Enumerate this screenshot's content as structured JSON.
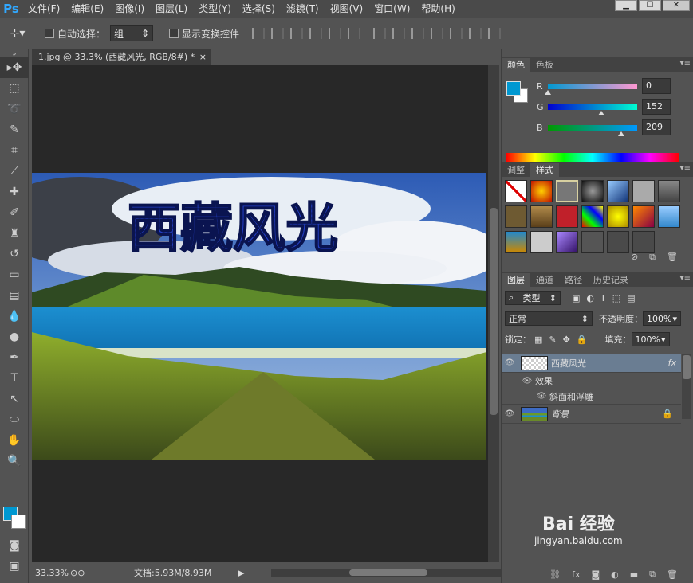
{
  "app": {
    "logo": "Ps"
  },
  "menu": [
    "文件(F)",
    "编辑(E)",
    "图像(I)",
    "图层(L)",
    "类型(Y)",
    "选择(S)",
    "滤镜(T)",
    "视图(V)",
    "窗口(W)",
    "帮助(H)"
  ],
  "window_controls": {
    "minimize": "▁",
    "maximize": "☐",
    "close": "✕"
  },
  "options": {
    "auto_select_label": "自动选择：",
    "auto_select_value": "组",
    "show_transform_label": "显示变换控件"
  },
  "document": {
    "tab_title": "1.jpg @ 33.3% (西藏风光, RGB/8#) *",
    "close": "×",
    "photo_text": "西藏风光"
  },
  "status": {
    "zoom": "33.33%",
    "doc_info": "文档:5.93M/8.93M"
  },
  "color_panel": {
    "tabs": [
      "颜色",
      "色板"
    ],
    "r_label": "R",
    "g_label": "G",
    "b_label": "B",
    "r": "0",
    "g": "152",
    "b": "209",
    "fg_color": "#0098d1"
  },
  "styles_panel": {
    "tabs": [
      "调整",
      "样式"
    ]
  },
  "layers_panel": {
    "tabs": [
      "图层",
      "通道",
      "路径",
      "历史记录"
    ],
    "filter_label": "类型",
    "blend_mode": "正常",
    "opacity_label": "不透明度：",
    "opacity": "100%",
    "lock_label": "锁定：",
    "fill_label": "填充：",
    "fill": "100%",
    "layers": [
      {
        "name": "西藏风光",
        "fx": "fx"
      },
      {
        "name": "效果"
      },
      {
        "name": "斜面和浮雕"
      },
      {
        "name": "背景"
      }
    ]
  },
  "watermark": {
    "line1": "Bai 经验",
    "line2": "jingyan.baidu.com"
  }
}
